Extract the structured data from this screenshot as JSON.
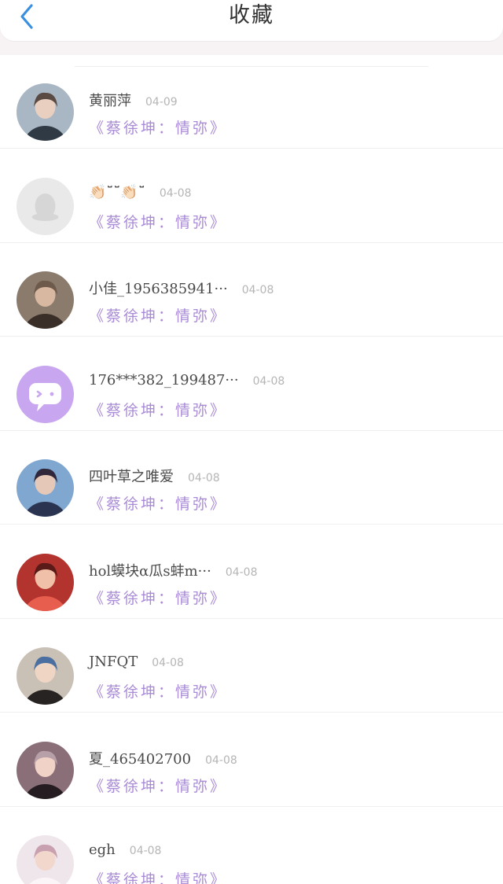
{
  "header": {
    "title": "收藏",
    "back_icon": "chevron-left-icon"
  },
  "colors": {
    "back_arrow": "#3b8fe0",
    "song_link": "#a98bd6",
    "date": "#b5b5b5",
    "page_bg": "#f7f3f5"
  },
  "favorites": [
    {
      "user": "黄丽萍",
      "date": "04-09",
      "song": "《蔡徐坤：情弥》",
      "avatar": "photo-avatar"
    },
    {
      "user": "👏🏻˘̈˘̈👏🏻˘̈",
      "date": "04-08",
      "song": "《蔡徐坤：情弥》",
      "avatar": "default-penguin-avatar"
    },
    {
      "user": "小佳_1956385941···",
      "date": "04-08",
      "song": "《蔡徐坤：情弥》",
      "avatar": "photo-avatar"
    },
    {
      "user": "176***382_199487···",
      "date": "04-08",
      "song": "《蔡徐坤：情弥》",
      "avatar": "chat-bubble-avatar"
    },
    {
      "user": "四叶草之唯爱",
      "date": "04-08",
      "song": "《蔡徐坤：情弥》",
      "avatar": "photo-avatar"
    },
    {
      "user": "hol蟆块α瓜s蚌m···",
      "date": "04-08",
      "song": "《蔡徐坤：情弥》",
      "avatar": "photo-avatar"
    },
    {
      "user": "JNFQT",
      "date": "04-08",
      "song": "《蔡徐坤：情弥》",
      "avatar": "photo-avatar"
    },
    {
      "user": "夏_465402700",
      "date": "04-08",
      "song": "《蔡徐坤：情弥》",
      "avatar": "photo-avatar"
    },
    {
      "user": "egh",
      "date": "04-08",
      "song": "《蔡徐坤：情弥》",
      "avatar": "photo-avatar"
    }
  ]
}
